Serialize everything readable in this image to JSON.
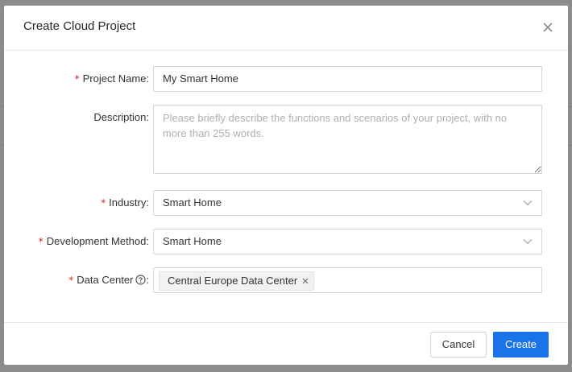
{
  "modal": {
    "title": "Create Cloud Project"
  },
  "form": {
    "project_name": {
      "label": "Project Name",
      "colon": ":",
      "value": "My Smart Home",
      "required_mark": "*"
    },
    "description": {
      "label": "Description",
      "colon": ":",
      "placeholder": "Please briefly describe the functions and scenarios of your project, with no more than 255 words."
    },
    "industry": {
      "label": "Industry",
      "colon": ":",
      "value": "Smart Home",
      "required_mark": "*"
    },
    "development_method": {
      "label": "Development Method",
      "colon": ":",
      "value": "Smart Home",
      "required_mark": "*"
    },
    "data_center": {
      "label": "Data Center",
      "colon": ":",
      "required_mark": "*",
      "tags": [
        "Central Europe Data Center"
      ]
    }
  },
  "footer": {
    "cancel_label": "Cancel",
    "create_label": "Create"
  },
  "icons": {
    "close": "close-icon",
    "chevron": "chevron-down-icon",
    "help": "question-circle-icon",
    "tag_remove": "tag-close-icon"
  },
  "colors": {
    "primary": "#1a73e8",
    "required": "#e02020"
  }
}
